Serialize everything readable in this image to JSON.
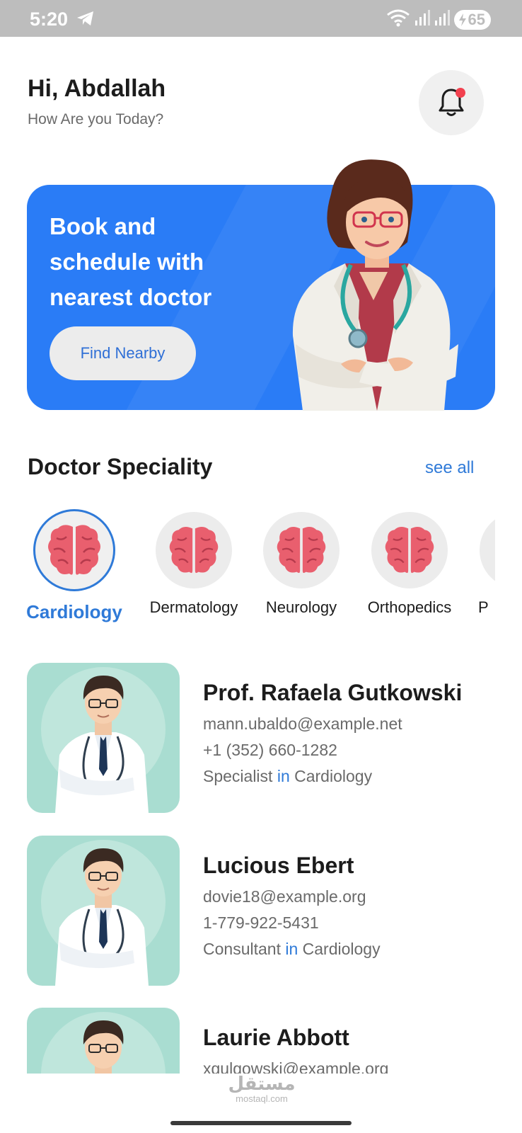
{
  "status_bar": {
    "time": "5:20",
    "battery": "65",
    "icons": [
      "telegram-icon",
      "wifi-icon",
      "signal-icon",
      "signal-icon",
      "battery-charging-icon"
    ]
  },
  "header": {
    "greeting": "Hi, Abdallah",
    "subtitle": "How Are you Today?",
    "notification_icon": "bell-icon"
  },
  "banner": {
    "title": "Book and schedule with nearest doctor",
    "button_label": "Find Nearby",
    "background_color": "#2a7cf6"
  },
  "speciality": {
    "title": "Doctor Speciality",
    "see_all_label": "see all",
    "selected": "Cardiology",
    "items": [
      {
        "label": "Cardiology",
        "icon": "brain-icon"
      },
      {
        "label": "Dermatology",
        "icon": "brain-icon"
      },
      {
        "label": "Neurology",
        "icon": "brain-icon"
      },
      {
        "label": "Orthopedics",
        "icon": "brain-icon"
      },
      {
        "label": "P",
        "icon": "brain-icon"
      }
    ]
  },
  "doctors": [
    {
      "name": "Prof. Rafaela Gutkowski",
      "email": "mann.ubaldo@example.net",
      "phone": "+1 (352) 660-1282",
      "role": "Specialist",
      "in_word": "in",
      "speciality": "Cardiology"
    },
    {
      "name": "Lucious Ebert",
      "email": "dovie18@example.org",
      "phone": "1-779-922-5431",
      "role": "Consultant",
      "in_word": "in",
      "speciality": "Cardiology"
    },
    {
      "name": "Laurie Abbott",
      "email": "xgulgowski@example.org"
    }
  ],
  "watermark": {
    "arabic": "مستقل",
    "latin": "mostaql.com"
  },
  "colors": {
    "accent": "#2f7ad8",
    "notification_dot": "#f2414f",
    "card_background": "#a9ddd1"
  }
}
